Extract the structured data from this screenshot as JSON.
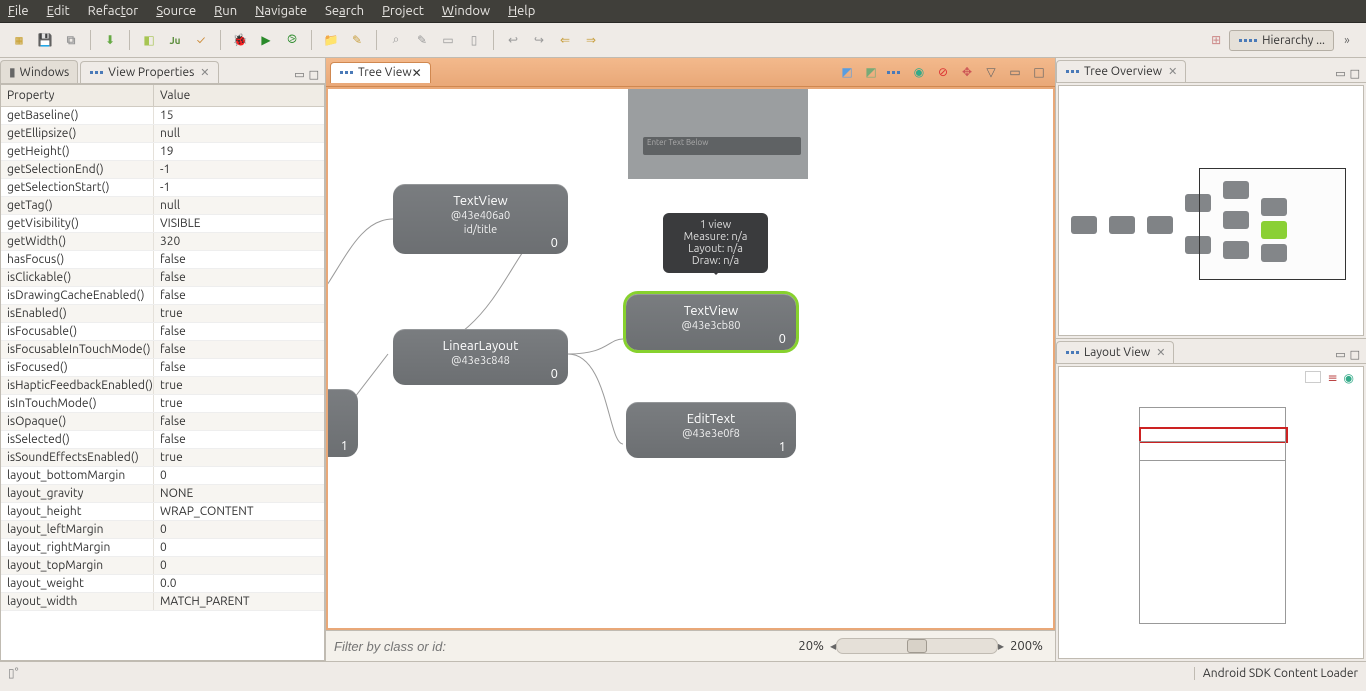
{
  "menu": {
    "file": "File",
    "edit": "Edit",
    "refactor": "Refactor",
    "source": "Source",
    "run": "Run",
    "navigate": "Navigate",
    "search": "Search",
    "project": "Project",
    "window": "Window",
    "help": "Help"
  },
  "perspective": {
    "label": "Hierarchy ..."
  },
  "leftTabs": {
    "windows": "Windows",
    "viewProperties": "View Properties"
  },
  "propHeader": {
    "property": "Property",
    "value": "Value"
  },
  "properties": [
    {
      "k": "getBaseline()",
      "v": "15"
    },
    {
      "k": "getEllipsize()",
      "v": "null"
    },
    {
      "k": "getHeight()",
      "v": "19"
    },
    {
      "k": "getSelectionEnd()",
      "v": "-1"
    },
    {
      "k": "getSelectionStart()",
      "v": "-1"
    },
    {
      "k": "getTag()",
      "v": "null"
    },
    {
      "k": "getVisibility()",
      "v": "VISIBLE"
    },
    {
      "k": "getWidth()",
      "v": "320"
    },
    {
      "k": "hasFocus()",
      "v": "false"
    },
    {
      "k": "isClickable()",
      "v": "false"
    },
    {
      "k": "isDrawingCacheEnabled()",
      "v": "false"
    },
    {
      "k": "isEnabled()",
      "v": "true"
    },
    {
      "k": "isFocusable()",
      "v": "false"
    },
    {
      "k": "isFocusableInTouchMode()",
      "v": "false"
    },
    {
      "k": "isFocused()",
      "v": "false"
    },
    {
      "k": "isHapticFeedbackEnabled()",
      "v": "true"
    },
    {
      "k": "isInTouchMode()",
      "v": "true"
    },
    {
      "k": "isOpaque()",
      "v": "false"
    },
    {
      "k": "isSelected()",
      "v": "false"
    },
    {
      "k": "isSoundEffectsEnabled()",
      "v": "true"
    },
    {
      "k": "layout_bottomMargin",
      "v": "0"
    },
    {
      "k": "layout_gravity",
      "v": "NONE"
    },
    {
      "k": "layout_height",
      "v": "WRAP_CONTENT"
    },
    {
      "k": "layout_leftMargin",
      "v": "0"
    },
    {
      "k": "layout_rightMargin",
      "v": "0"
    },
    {
      "k": "layout_topMargin",
      "v": "0"
    },
    {
      "k": "layout_weight",
      "v": "0.0"
    },
    {
      "k": "layout_width",
      "v": "MATCH_PARENT"
    }
  ],
  "treeView": {
    "title": "Tree View"
  },
  "previewPlaceholder": "Enter Text Below",
  "tooltip": {
    "l1": "1 view",
    "l2": "Measure: n/a",
    "l3": "Layout: n/a",
    "l4": "Draw: n/a"
  },
  "nodes": {
    "tv1": {
      "name": "TextView",
      "id": "@43e406a0",
      "extra": "id/title",
      "cnt": "0"
    },
    "ll": {
      "name": "LinearLayout",
      "id": "@43e3c848",
      "cnt": "0"
    },
    "leftPartial": {
      "cnt": "1"
    },
    "tv2": {
      "name": "TextView",
      "id": "@43e3cb80",
      "cnt": "0"
    },
    "et": {
      "name": "EditText",
      "id": "@43e3e0f8",
      "cnt": "1"
    }
  },
  "filter": {
    "placeholder": "Filter by class or id:",
    "zoomLow": "20%",
    "zoomHigh": "200%"
  },
  "rightTabs": {
    "overview": "Tree Overview",
    "layout": "Layout View"
  },
  "status": {
    "right": "Android SDK Content Loader"
  }
}
